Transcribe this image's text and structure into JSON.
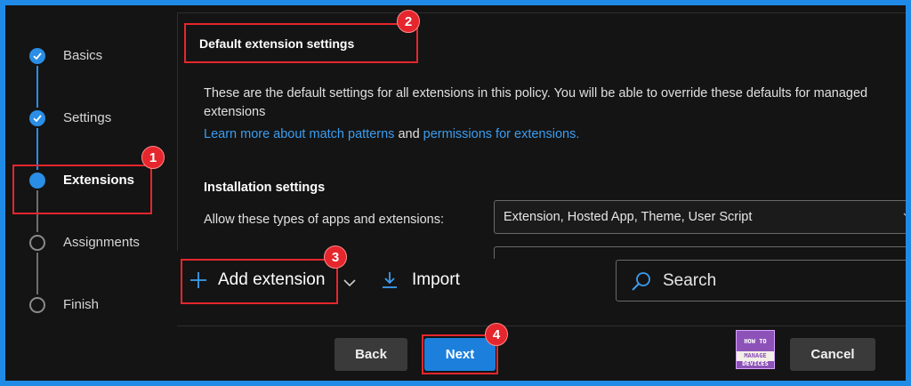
{
  "wizard": {
    "steps": [
      {
        "label": "Basics",
        "state": "done"
      },
      {
        "label": "Settings",
        "state": "done"
      },
      {
        "label": "Extensions",
        "state": "current"
      },
      {
        "label": "Assignments",
        "state": "todo"
      },
      {
        "label": "Finish",
        "state": "todo"
      }
    ]
  },
  "panel": {
    "title": "Default extension settings",
    "description": "These are the default settings for all extensions in this policy. You will be able to override these defaults for managed extensions",
    "link1": "Learn more about match patterns",
    "and_text": "and",
    "link2": "permissions for extensions.",
    "installation_title": "Installation settings",
    "allow_label": "Allow these types of apps and extensions:",
    "allow_value": "Extension, Hosted App, Theme, User Script"
  },
  "toolbar": {
    "add_extension": "Add extension",
    "import": "Import",
    "search_placeholder": "Search"
  },
  "footer": {
    "back": "Back",
    "next": "Next",
    "cancel": "Cancel"
  },
  "logo": {
    "line1": "HOW TO",
    "line2": "MANAGE",
    "line3": "DEVICES"
  },
  "callouts": [
    "1",
    "2",
    "3",
    "4"
  ],
  "colors": {
    "accent": "#2a8ee6",
    "callout": "#e5262d",
    "background": "#141414",
    "border": "#1f8be6"
  }
}
